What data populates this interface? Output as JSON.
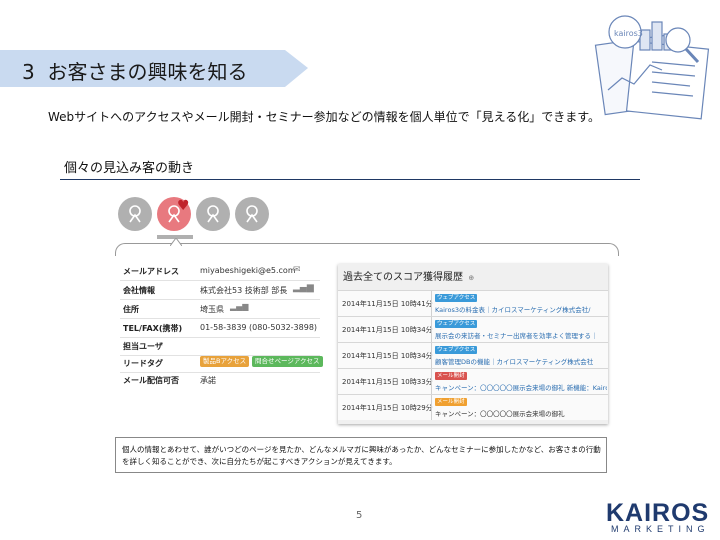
{
  "title": {
    "number": "3",
    "text": "お客さまの興味を知る"
  },
  "subtitle": "Webサイトへのアクセスやメール開封・セミナー参加などの情報を個人単位で「見える化」できます。",
  "section_heading": "個々の見込み客の動き",
  "illustration_badge": "kairos3",
  "profile": {
    "rows": [
      {
        "label": "メールアドレス",
        "value": "miyabeshigeki@e5.com"
      },
      {
        "label": "会社情報",
        "value": "株式会社53 技術部 部長"
      },
      {
        "label": "住所",
        "value": "埼玉県"
      },
      {
        "label": "TEL/FAX(携帯)",
        "value": "01-58-3839 (080-5032-3898)"
      },
      {
        "label": "担当ユーザ",
        "value": ""
      },
      {
        "label": "リードタグ",
        "value": ""
      },
      {
        "label": "メール配信可否",
        "value": "承諾"
      }
    ],
    "tags": [
      {
        "label": "製品Bアクセス",
        "color": "#e8a23b"
      },
      {
        "label": "問合せページアクセス",
        "color": "#5cb85c"
      }
    ]
  },
  "history": {
    "title": "過去全てのスコア獲得履歴",
    "rows": [
      {
        "date": "2014年11月15日 10時41分",
        "tag": "ウェブアクセス",
        "tag_color": "#3a9ad9",
        "desc": "Kairos3の料金表｜カイロスマーケティング株式会社/"
      },
      {
        "date": "2014年11月15日 10時34分",
        "tag": "ウェブアクセス",
        "tag_color": "#3a9ad9",
        "desc": "展示会の来訪者・セミナー出席者を効率よく管理する｜"
      },
      {
        "date": "2014年11月15日 10時34分",
        "tag": "ウェブアクセス",
        "tag_color": "#3a9ad9",
        "desc": "顧客管理DBの機能｜カイロスマーケティング株式会社"
      },
      {
        "date": "2014年11月15日 10時33分",
        "tag": "メール開封",
        "tag_color": "#d9534f",
        "desc": "キャンペーン：〇〇〇〇〇展示会来場の御礼 新機能：Kairos3の顧客管理機能"
      },
      {
        "date": "2014年11月15日 10時29分",
        "tag": "メール開封",
        "tag_color": "#f0a030",
        "desc": "キャンペーン：〇〇〇〇〇展示会来場の御礼"
      }
    ]
  },
  "note": "個人の情報とあわせて、誰がいつどのページを見たか、どんなメルマガに興味があったか、どんなセミナーに参加したかなど、お客さまの行動を詳しく知ることができ、次に自分たちが起こすべきアクションが見えてきます。",
  "page_number": "5",
  "logo": {
    "main": "KAIROS",
    "sub": "MARKETING"
  },
  "colors": {
    "banner": "#c9daf0",
    "accent": "#1f3a6e",
    "active_person": "#e8797f",
    "heart": "#c0232c"
  }
}
